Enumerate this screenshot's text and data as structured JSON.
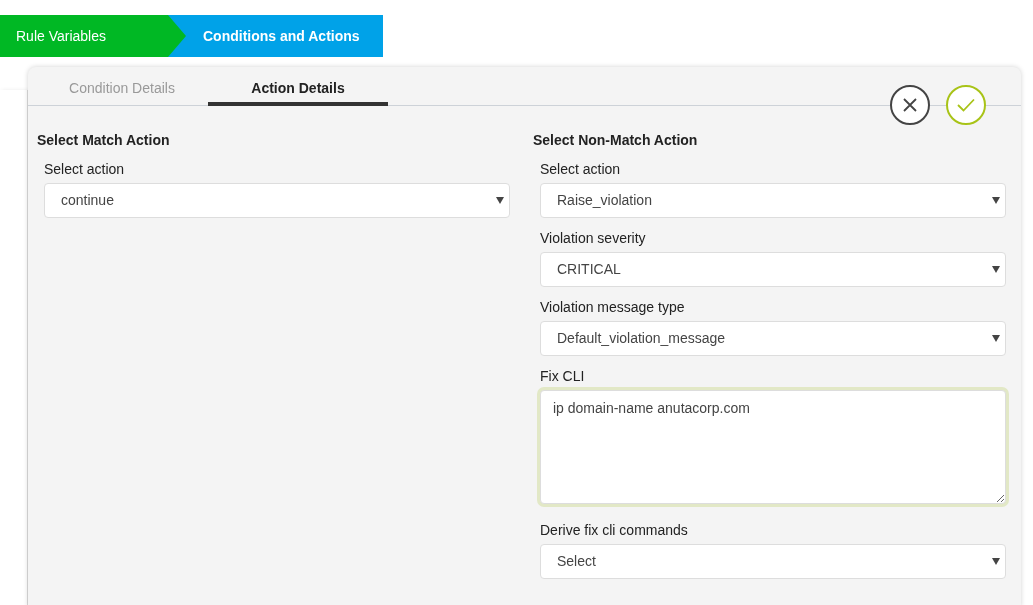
{
  "wizard_steps": [
    {
      "label": "Rule Variables",
      "selected": false
    },
    {
      "label": "Conditions and Actions",
      "selected": true
    }
  ],
  "tabs": [
    {
      "label": "Condition Details",
      "selected": false
    },
    {
      "label": "Action Details",
      "selected": true
    }
  ],
  "sections": [
    {
      "title": "Select Match Action",
      "fields": [
        {
          "kind": "select",
          "label": "Select action",
          "value": "continue"
        }
      ]
    },
    {
      "title": "Select Non-Match Action",
      "fields": [
        {
          "kind": "select",
          "label": "Select action",
          "value": "Raise_violation"
        },
        {
          "kind": "select",
          "label": "Violation severity",
          "value": "CRITICAL"
        },
        {
          "kind": "select",
          "label": "Violation message type",
          "value": "Default_violation_message"
        },
        {
          "kind": "textarea",
          "label": "Fix CLI",
          "value": "ip domain-name anutacorp.com",
          "focused": true
        },
        {
          "kind": "select",
          "label": "Derive fix cli commands",
          "value": "Select"
        }
      ]
    }
  ]
}
